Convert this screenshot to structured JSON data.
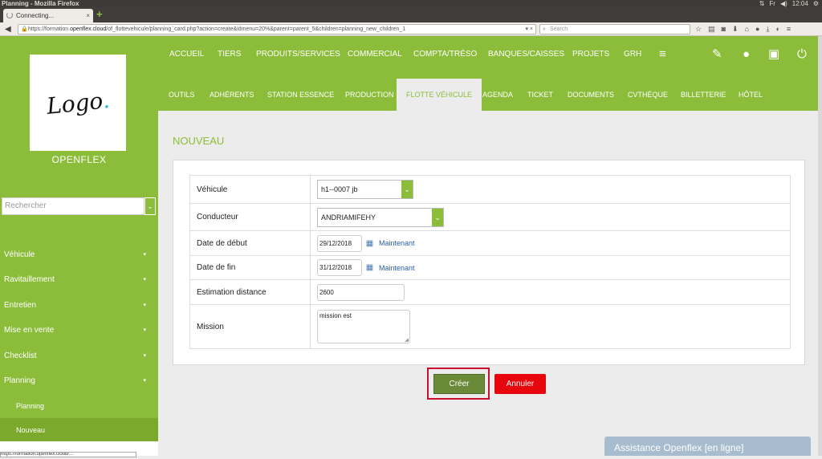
{
  "os": {
    "window_title": "Planning - Mozilla Firefox",
    "clock": "12:04",
    "lang": "Fr"
  },
  "browser": {
    "tab_title": "Connecting...",
    "url_prefix": "https://formation.",
    "url_domain": "openflex.cloud",
    "url_rest": "/of_flottevehicule/planning_card.php?action=create&idmenu=20%&parent=parent_5&children=planning_new_children_1",
    "search_placeholder": "Search"
  },
  "sidebar": {
    "logo_text": "Logo",
    "brand": "OPENFLEX",
    "search_placeholder": "Rechercher",
    "items": [
      {
        "label": "Véhicule"
      },
      {
        "label": "Ravitaillement"
      },
      {
        "label": "Entretien"
      },
      {
        "label": "Mise en vente"
      },
      {
        "label": "Checklist"
      },
      {
        "label": "Planning"
      }
    ],
    "subitems": [
      {
        "label": "Planning"
      },
      {
        "label": "Nouveau"
      }
    ]
  },
  "topnav": [
    "ACCUEIL",
    "TIERS",
    "PRODUITS/SERVICES",
    "COMMERCIAL",
    "COMPTA/TRÉSO",
    "BANQUES/CAISSES",
    "PROJETS",
    "GRH"
  ],
  "subnav": [
    "OUTILS",
    "ADHÉRENTS",
    "STATION ESSENCE",
    "PRODUCTION",
    "FLOTTE VÉHICULE",
    "AGENDA",
    "TICKET",
    "DOCUMENTS",
    "CVTHÈQUE",
    "BILLETTERIE",
    "HÔTEL"
  ],
  "page": {
    "heading": "NOUVEAU"
  },
  "form": {
    "vehicule": {
      "label": "Véhicule",
      "value": "h1--0007 jb"
    },
    "conducteur": {
      "label": "Conducteur",
      "value": "ANDRIAMIFEHY"
    },
    "date_debut": {
      "label": "Date de début",
      "value": "29/12/2018",
      "now_link": "Maintenant"
    },
    "date_fin": {
      "label": "Date de fin",
      "value": "31/12/2018",
      "now_link": "Maintenant"
    },
    "distance": {
      "label": "Estimation distance",
      "value": "2600"
    },
    "mission": {
      "label": "Mission",
      "value": "mission est"
    }
  },
  "buttons": {
    "create": "Créer",
    "cancel": "Annuler"
  },
  "assistance": "Assistance Openflex [en ligne]",
  "statusbar": "https://formation.openflex.cloud/..."
}
